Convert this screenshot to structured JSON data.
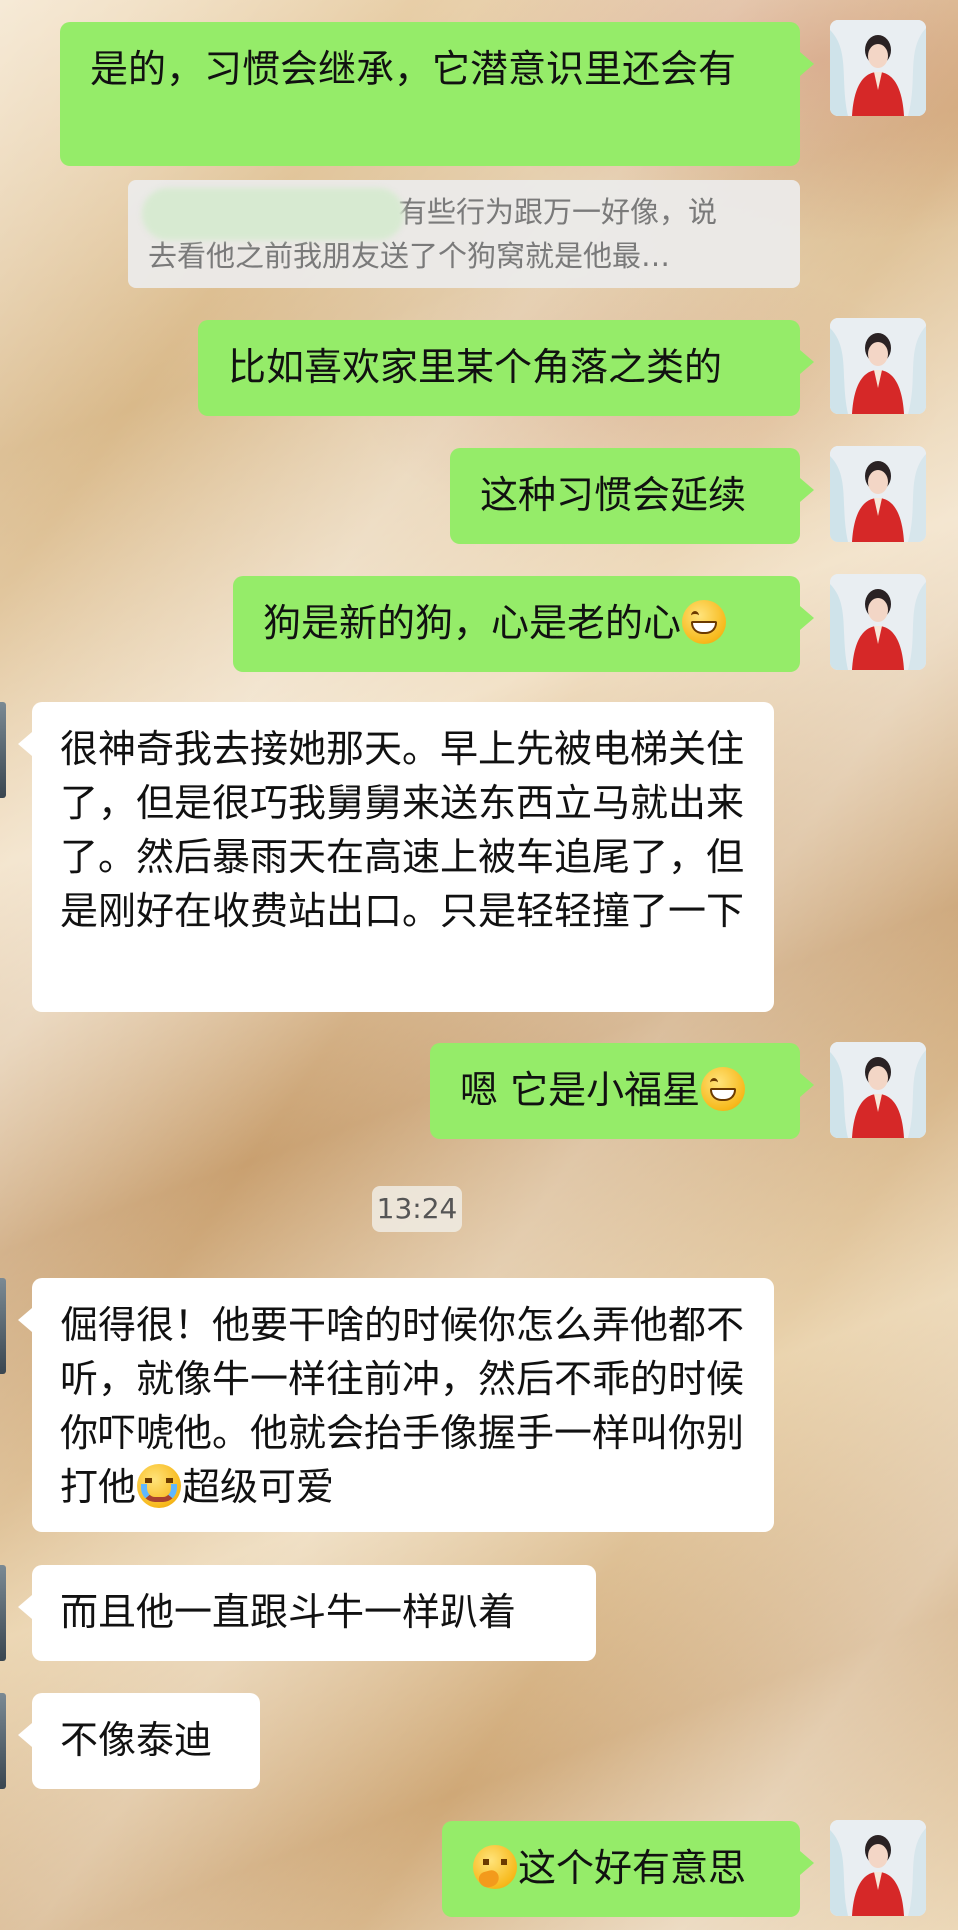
{
  "messages": [
    {
      "id": "m1",
      "side": "me",
      "text": "是的，习惯会继承，它潜意识里还会有"
    },
    {
      "id": "m2",
      "side": "me",
      "text": "比如喜欢家里某个角落之类的"
    },
    {
      "id": "m3",
      "side": "me",
      "text": "这种习惯会延续"
    },
    {
      "id": "m4",
      "side": "me",
      "text": "狗是新的狗，心是老的心",
      "emoji": "grinning-face-emoji"
    },
    {
      "id": "m5",
      "side": "them",
      "text": "很神奇我去接她那天。早上先被电梯关住了，但是很巧我舅舅来送东西立马就出来了。然后暴雨天在高速上被车追尾了，但是刚好在收费站出口。只是轻轻撞了一下"
    },
    {
      "id": "m6",
      "side": "me",
      "text": "嗯 它是小福星",
      "emoji": "grinning-face-emoji"
    },
    {
      "id": "m7",
      "side": "them",
      "text_before": "倔得很！他要干啥的时候你怎么弄他都不听，就像牛一样往前冲，然后不乖的时候你吓唬他。他就会抬手像握手一样叫你别打他",
      "emoji": "crying-face-emoji",
      "text_after": "超级可爱"
    },
    {
      "id": "m8",
      "side": "them",
      "text": "而且他一直跟斗牛一样趴着"
    },
    {
      "id": "m9",
      "side": "them",
      "text": "不像泰迪"
    },
    {
      "id": "m10",
      "side": "me",
      "emoji": "thinking-face-emoji",
      "text": "这个好有意思"
    }
  ],
  "quote": {
    "line1": "有些行为跟万一好像，说",
    "line2": "去看他之前我朋友送了个狗窝就是他最…"
  },
  "timestamp": "13:24",
  "colors": {
    "my_bubble": "#95ec69",
    "their_bubble": "#ffffff"
  }
}
